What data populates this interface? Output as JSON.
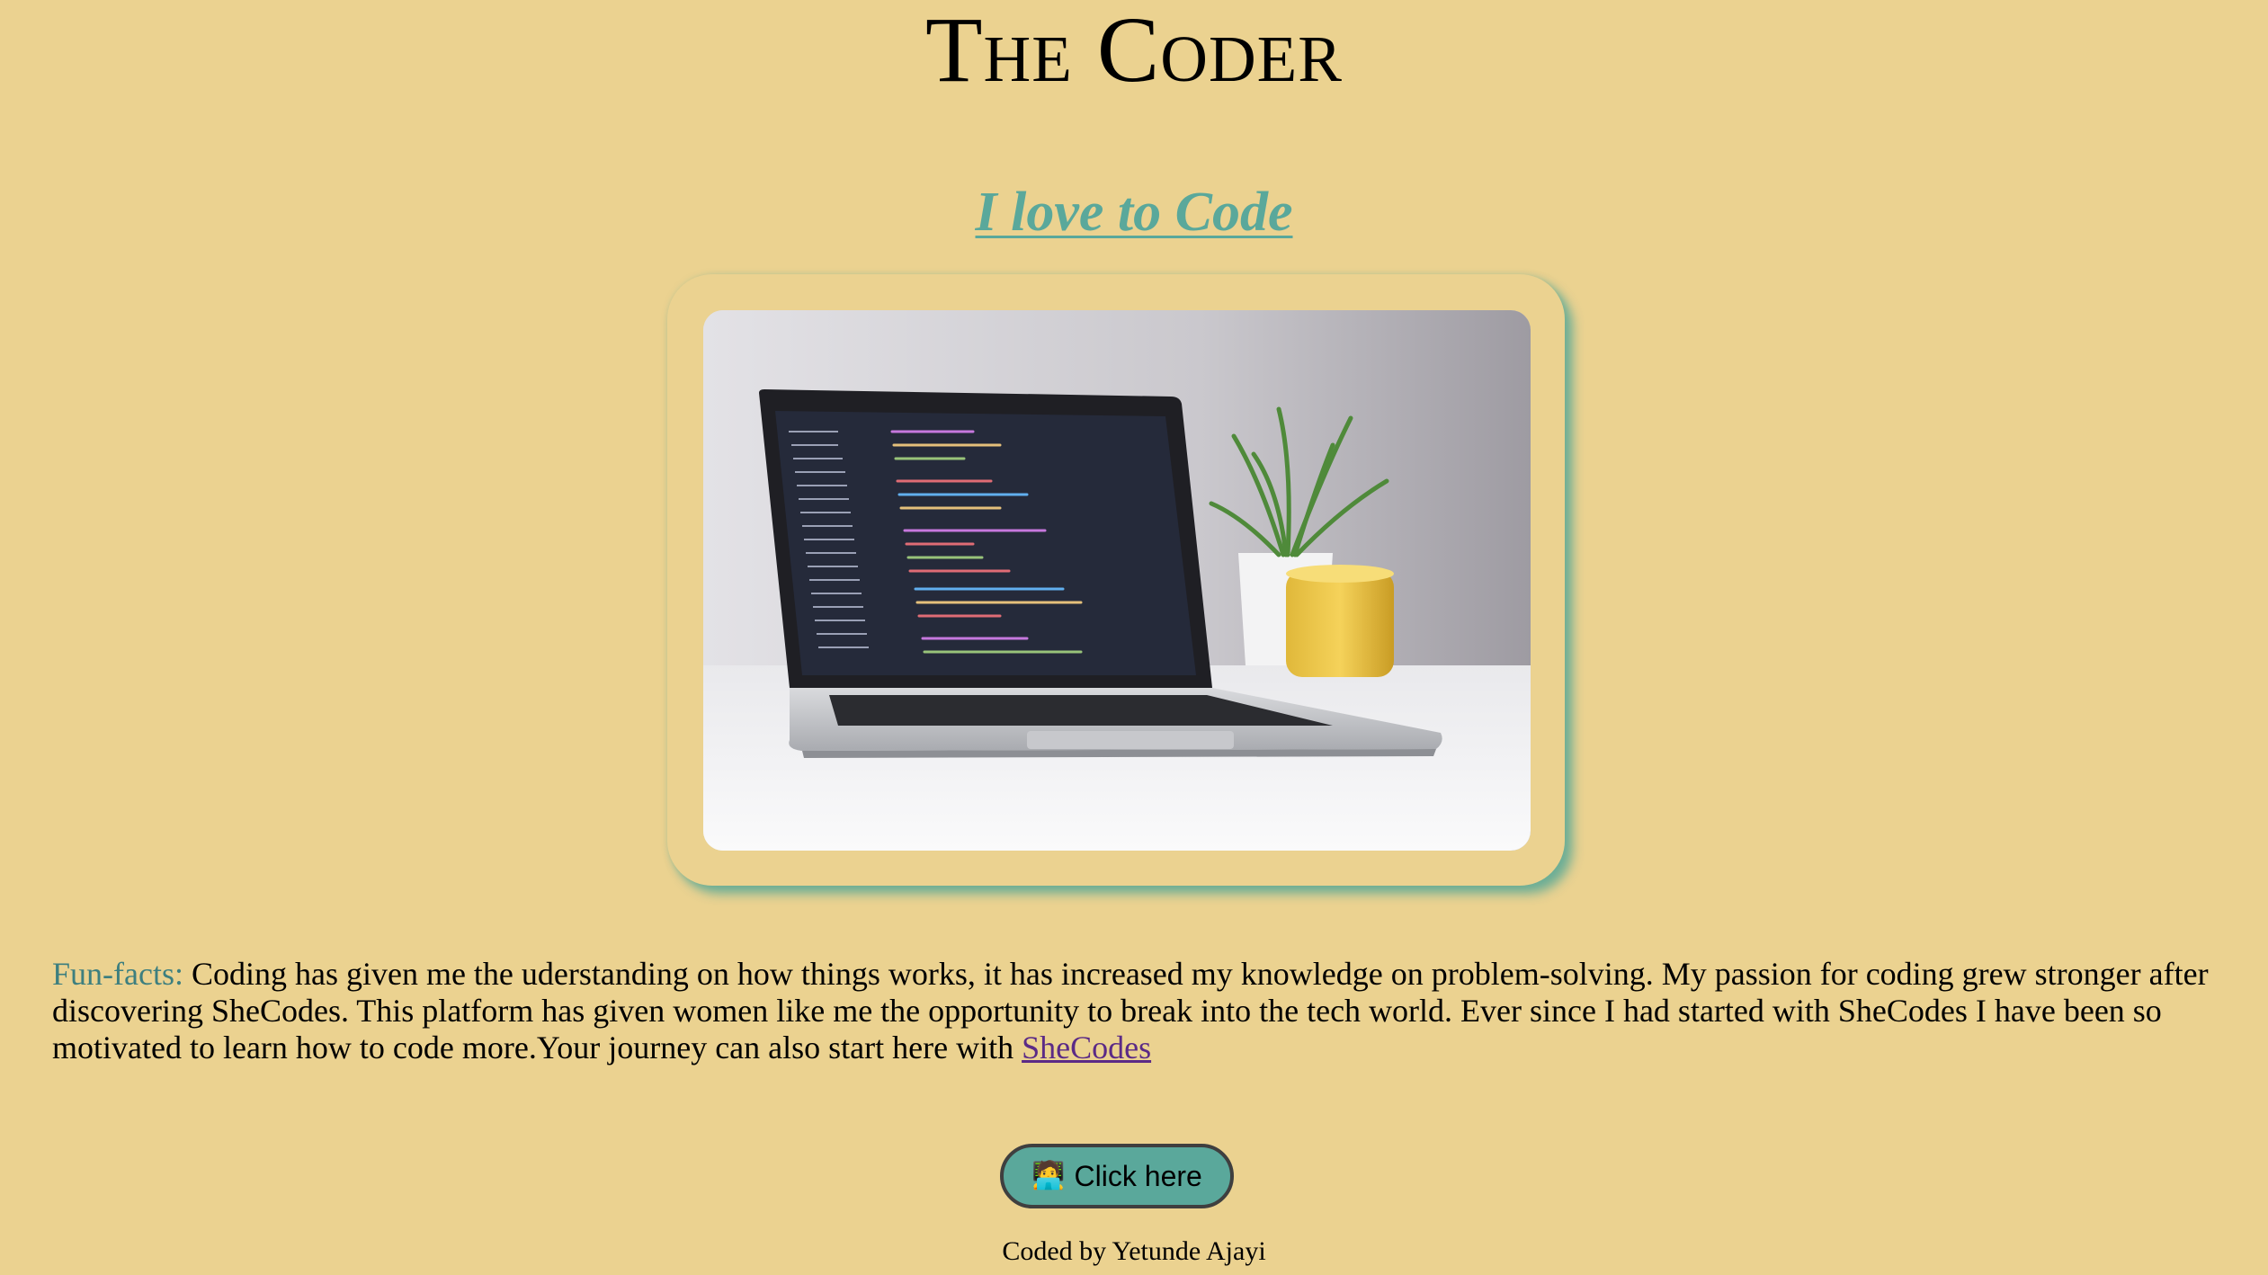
{
  "header": {
    "title": "The Coder",
    "subtitle": "I love to Code"
  },
  "hero": {
    "image_alt": "Laptop with code editor next to a plant and yellow cup"
  },
  "content": {
    "funfacts_label": "Fun-facts:",
    "funfacts_text": " Coding has given me the uderstanding on how things works, it has increased my knowledge on problem-solving. My passion for coding grew stronger after discovering SheCodes. This platform has given women like me the opportunity to break into the tech world. Ever since I had started with SheCodes I have been so motivated to learn how to code more.Your journey can also start here with ",
    "link_text": "SheCodes"
  },
  "cta": {
    "emoji": "🧑‍💻",
    "label": "Click here"
  },
  "footer": {
    "credit": "Coded by Yetunde Ajayi"
  },
  "colors": {
    "background": "#ebd290",
    "accent": "#5aa89b",
    "label": "#3d7f7f",
    "link": "#5b2a86"
  }
}
